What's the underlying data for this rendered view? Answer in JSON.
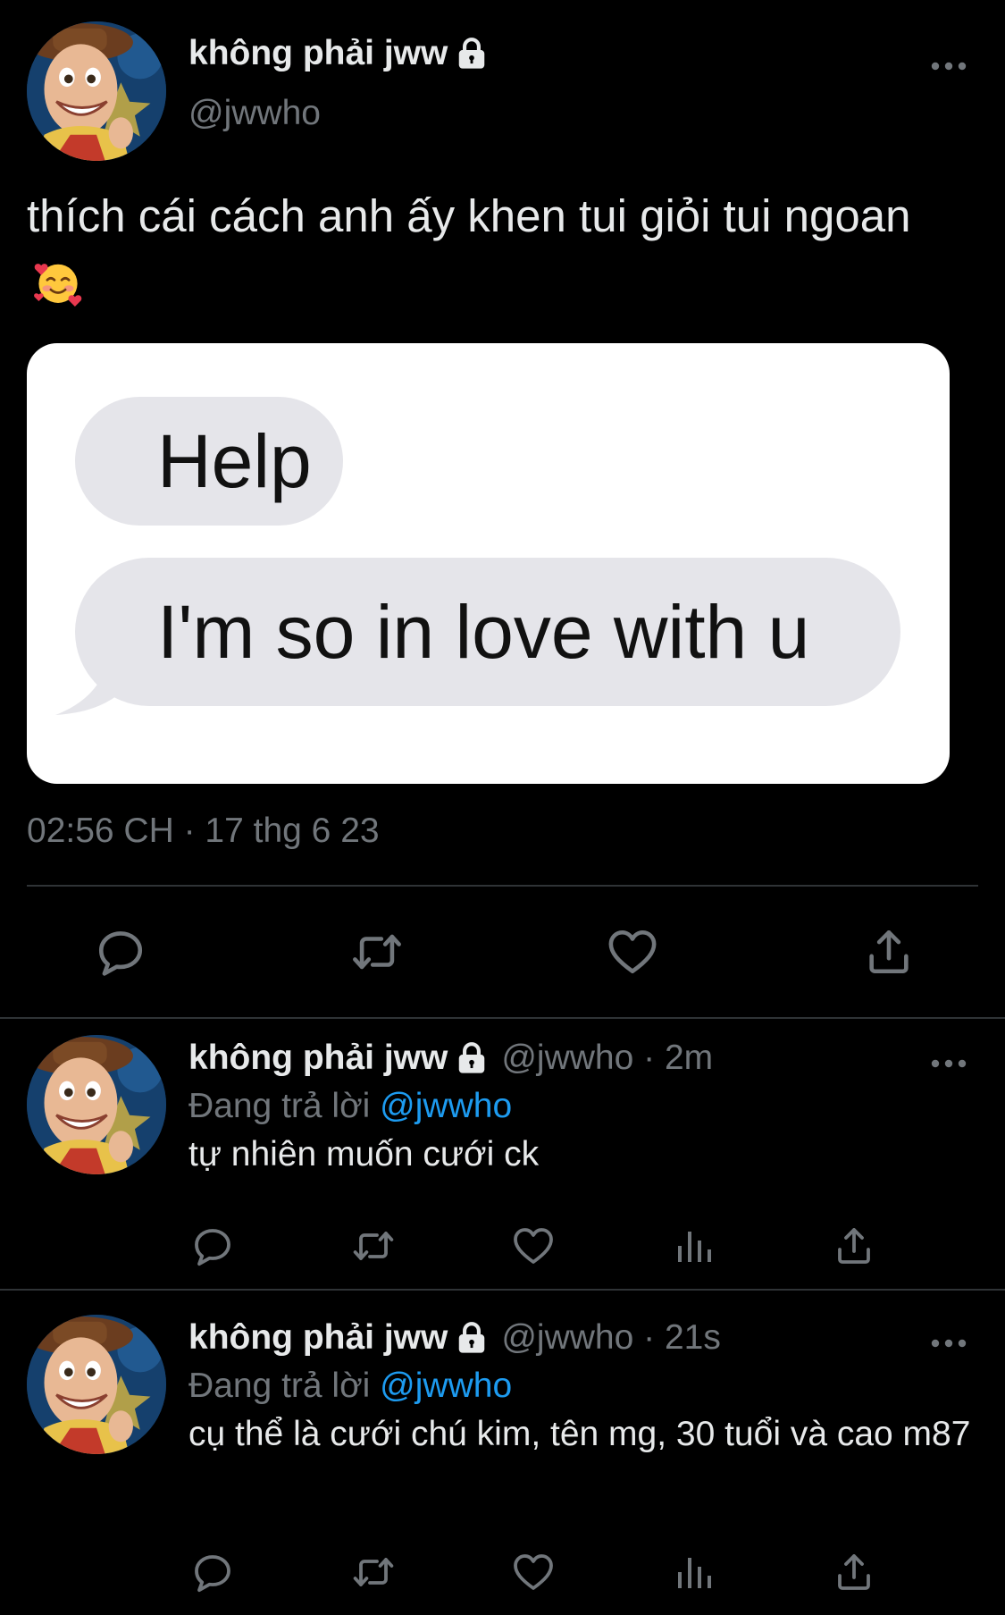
{
  "tweet": {
    "display_name": "không phải jww",
    "handle": "@jwwho",
    "text": "thích cái cách anh ấy khen tui giỏi tui ngoan",
    "emoji": "smiling-face-with-hearts",
    "timestamp": "02:56 CH · 17 thg 6 23",
    "media": {
      "bubble_1": "Help",
      "bubble_2": "I'm so in love with u"
    },
    "actions": [
      "reply",
      "retweet",
      "like",
      "share"
    ]
  },
  "replies": [
    {
      "display_name": "không phải jww",
      "handle_time": "@jwwho · 2m",
      "replying_to_label": "Đang trả lời",
      "replying_to_mention": "@jwwho",
      "text": "tự nhiên muốn cưới ck",
      "actions": [
        "reply",
        "retweet",
        "like",
        "views",
        "share"
      ]
    },
    {
      "display_name": "không phải jww",
      "handle_time": "@jwwho · 21s",
      "replying_to_label": "Đang trả lời",
      "replying_to_mention": "@jwwho",
      "text": "cụ thể là cưới chú kim, tên mg, 30 tuổi và cao m87",
      "actions": [
        "reply",
        "retweet",
        "like",
        "views",
        "share"
      ]
    }
  ],
  "colors": {
    "background": "#000000",
    "text": "#e7e9ea",
    "secondary": "#71767b",
    "mention": "#1d9bf0",
    "divider": "#2f3336"
  }
}
